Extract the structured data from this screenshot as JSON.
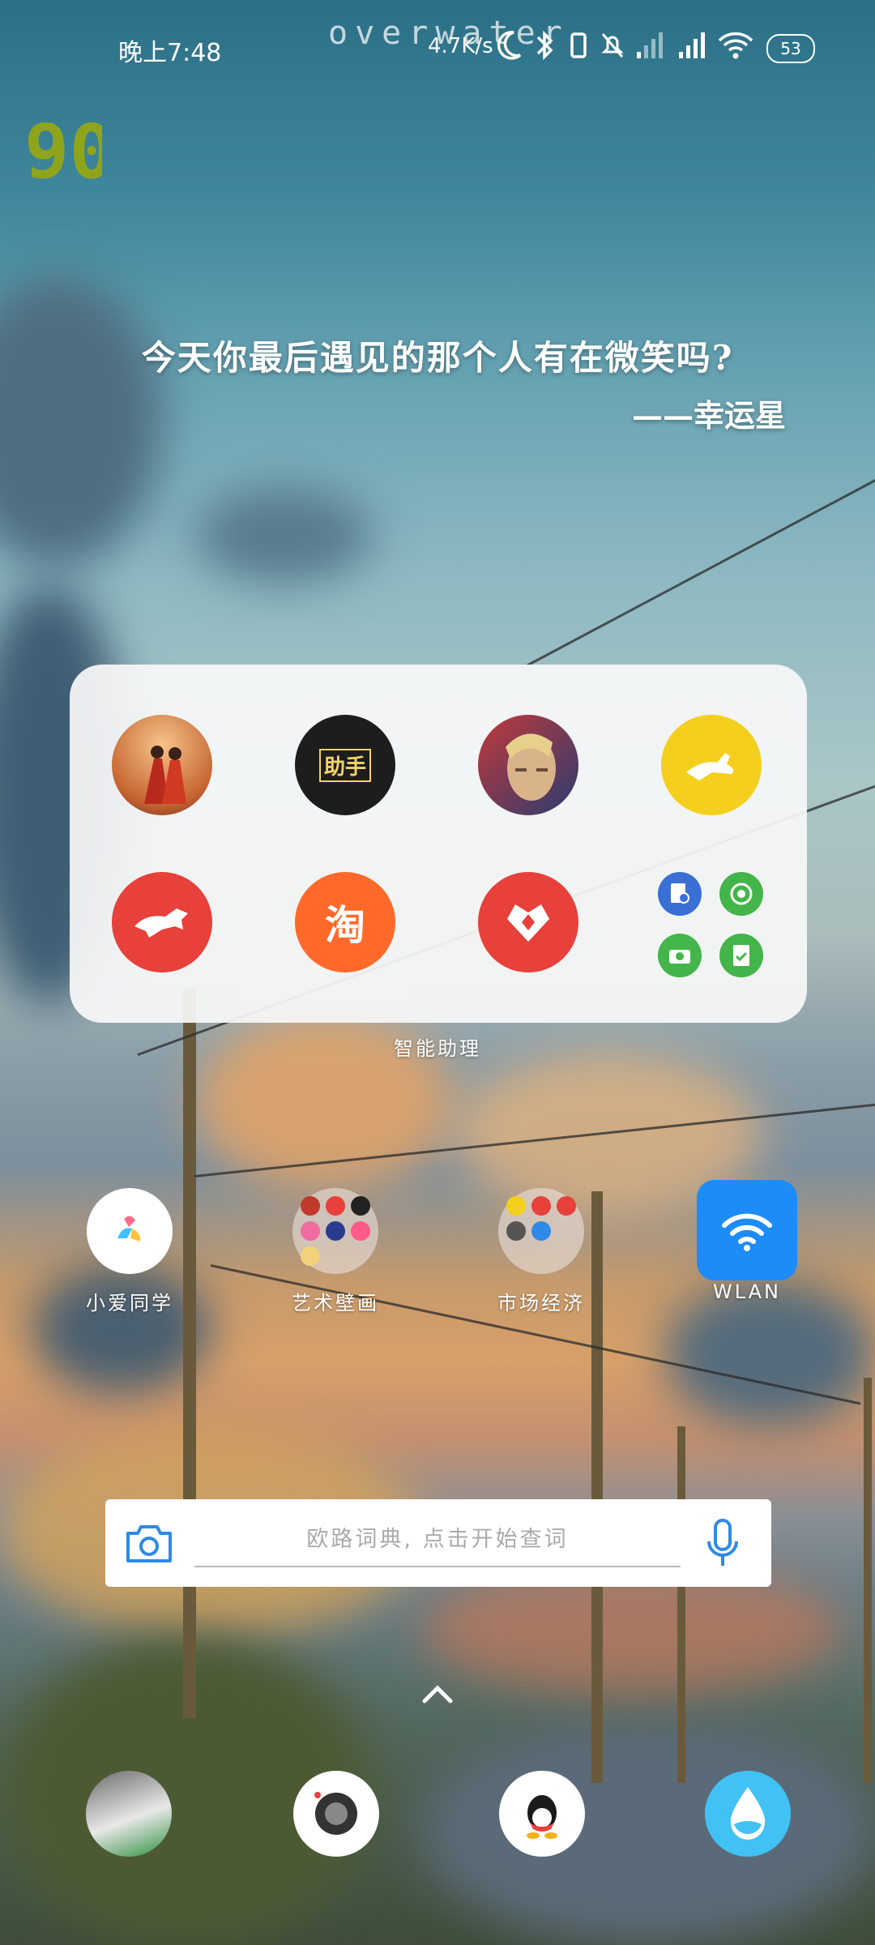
{
  "status_bar": {
    "time": "晚上7:48",
    "watermark": "overwater",
    "net_speed": "4.7K/s",
    "battery": "53",
    "icons": [
      "moon-icon",
      "bluetooth-icon",
      "vibrate-icon",
      "mute-icon",
      "signal-icon",
      "signal-icon",
      "wifi-icon",
      "battery-icon"
    ]
  },
  "widget_badge": "90",
  "quote": {
    "text": "今天你最后遇见的那个人有在微笑吗?",
    "author": "——幸运星"
  },
  "folder": {
    "name": "智能助理",
    "apps": [
      {
        "icon": "sky-game-icon"
      },
      {
        "icon": "helper-icon",
        "text": "助手"
      },
      {
        "icon": "hero-game-icon"
      },
      {
        "icon": "kangaroo-icon"
      },
      {
        "icon": "running-animal-icon"
      },
      {
        "icon": "taobao-icon",
        "text": "淘"
      },
      {
        "icon": "heart-gift-icon"
      },
      {
        "icon": "mini-apps-group-icon"
      }
    ]
  },
  "apps": [
    {
      "label": "小爱同学",
      "icon": "xiaoai-icon"
    },
    {
      "label": "艺术壁画",
      "icon": "folder-icon"
    },
    {
      "label": "市场经济",
      "icon": "folder-icon"
    },
    {
      "label": "WLAN",
      "icon": "wifi-icon"
    }
  ],
  "search": {
    "placeholder": "欧路词典, 点击开始查词"
  },
  "dock": [
    {
      "icon": "photo-icon"
    },
    {
      "icon": "camera-icon"
    },
    {
      "icon": "qq-icon"
    },
    {
      "icon": "water-drop-icon"
    }
  ],
  "colors": {
    "accent_red": "#e8403a",
    "taobao_orange": "#ff6a2b",
    "wlan_blue": "#1d8cf8",
    "yellow": "#f5cf1e",
    "badge_green": "#8fa41b"
  }
}
